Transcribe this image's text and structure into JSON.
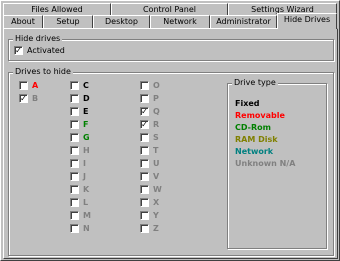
{
  "tabs_back": [
    "Files Allowed",
    "Control Panel",
    "Settings Wizard"
  ],
  "tabs_front": [
    "About",
    "Setup",
    "Desktop",
    "Network",
    "Administrator",
    "Hide Drives"
  ],
  "hide_drives": {
    "title": "Hide drives",
    "activated_label": "Activated",
    "activated": true
  },
  "drives_group": {
    "title": "Drives to hide"
  },
  "drive_columns": [
    [
      {
        "letter": "A",
        "color": "#ff0000",
        "checked": false
      },
      {
        "letter": "B",
        "color": "#808080",
        "checked": true
      }
    ],
    [
      {
        "letter": "C",
        "color": "#000000",
        "checked": false
      },
      {
        "letter": "D",
        "color": "#000000",
        "checked": false
      },
      {
        "letter": "E",
        "color": "#000000",
        "checked": false
      },
      {
        "letter": "F",
        "color": "#008000",
        "checked": false
      },
      {
        "letter": "G",
        "color": "#008000",
        "checked": false
      },
      {
        "letter": "H",
        "color": "#808080",
        "checked": false
      },
      {
        "letter": "I",
        "color": "#808080",
        "checked": false
      },
      {
        "letter": "J",
        "color": "#808080",
        "checked": false
      },
      {
        "letter": "K",
        "color": "#808080",
        "checked": false
      },
      {
        "letter": "L",
        "color": "#808080",
        "checked": false
      },
      {
        "letter": "M",
        "color": "#808080",
        "checked": false
      },
      {
        "letter": "N",
        "color": "#808080",
        "checked": false
      }
    ],
    [
      {
        "letter": "O",
        "color": "#808080",
        "checked": false
      },
      {
        "letter": "P",
        "color": "#808080",
        "checked": false
      },
      {
        "letter": "Q",
        "color": "#808080",
        "checked": true
      },
      {
        "letter": "R",
        "color": "#808080",
        "checked": true
      },
      {
        "letter": "S",
        "color": "#808080",
        "checked": false
      },
      {
        "letter": "T",
        "color": "#808080",
        "checked": false
      },
      {
        "letter": "U",
        "color": "#808080",
        "checked": false
      },
      {
        "letter": "V",
        "color": "#808080",
        "checked": false
      },
      {
        "letter": "W",
        "color": "#808080",
        "checked": false
      },
      {
        "letter": "X",
        "color": "#808080",
        "checked": false
      },
      {
        "letter": "Y",
        "color": "#808080",
        "checked": false
      },
      {
        "letter": "Z",
        "color": "#808080",
        "checked": false
      }
    ]
  ],
  "drive_type": {
    "title": "Drive type",
    "items": [
      {
        "label": "Fixed",
        "color": "#000000"
      },
      {
        "label": "Removable",
        "color": "#ff0000"
      },
      {
        "label": "CD-Rom",
        "color": "#008000"
      },
      {
        "label": "RAM Disk",
        "color": "#808000"
      },
      {
        "label": "Network",
        "color": "#008080"
      },
      {
        "label": "Unknown N/A",
        "color": "#808080"
      }
    ]
  }
}
